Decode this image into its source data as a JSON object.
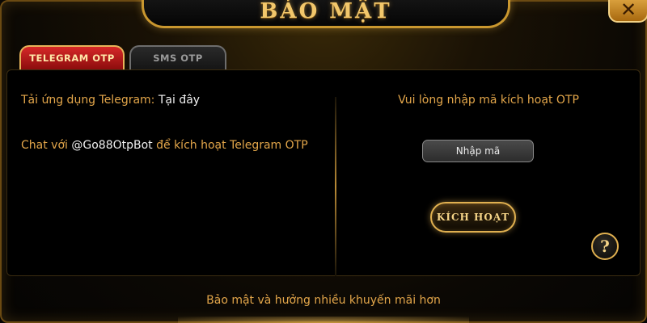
{
  "dialog": {
    "title": "BẢO MẬT",
    "close_symbol": "✕",
    "close_icon": "close-icon"
  },
  "tabs": [
    {
      "label": "TELEGRAM OTP",
      "active": true
    },
    {
      "label": "SMS OTP",
      "active": false
    }
  ],
  "left": {
    "row1_label": "Tải ứng dụng Telegram:",
    "row1_link": "Tại đây",
    "row2_prefix": "Chat với",
    "row2_bot": "@Go88OtpBot",
    "row2_suffix": "để kích hoạt Telegram OTP"
  },
  "right": {
    "instruction": "Vui lòng nhập mã kích hoạt OTP",
    "input_placeholder": "Nhập mã",
    "input_value": "",
    "activate_label": "KÍCH HOẠT",
    "help_symbol": "?",
    "help_icon": "help-icon"
  },
  "footer": {
    "text": "Bảo mật và hưởng nhiều khuyến mãi hơn"
  },
  "colors": {
    "accent_gold": "#e0b050",
    "text_orange": "#e3a64a",
    "active_tab_red": "#d62828"
  }
}
